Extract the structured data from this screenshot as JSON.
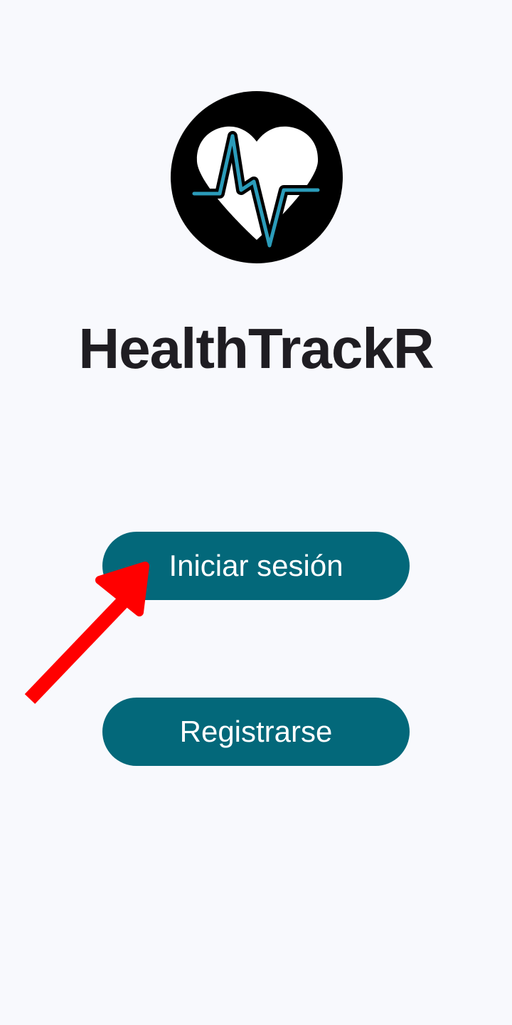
{
  "app": {
    "title": "HealthTrackR"
  },
  "logo": {
    "icon": "heart-pulse-icon",
    "circle_color": "#000000",
    "heart_color": "#ffffff",
    "pulse_color": "#2b9cba"
  },
  "actions": {
    "login_label": "Iniciar sesión",
    "register_label": "Registrarse"
  },
  "colors": {
    "background": "#f8f9fd",
    "button": "#03687a",
    "button_text": "#ffffff",
    "title": "#1f1d22",
    "annotation_arrow": "#ff0000"
  },
  "annotation": {
    "type": "arrow",
    "points_to": "login-button"
  }
}
